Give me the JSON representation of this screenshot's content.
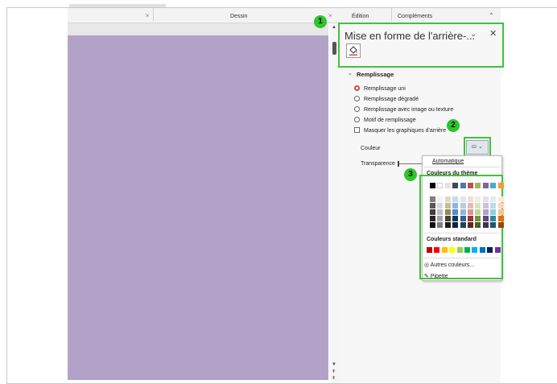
{
  "ribbon": {
    "groups": [
      {
        "label": "Dessin"
      },
      {
        "label": "Édition"
      },
      {
        "label": "Compléments"
      }
    ],
    "collapse_icon": "chevron-up-icon"
  },
  "pane": {
    "title": "Mise en forme de l'arrière-...",
    "fill_icon": "paint-bucket-icon",
    "section": "Remplissage",
    "options": [
      {
        "label": "Remplissage uni",
        "checked": true
      },
      {
        "label": "Remplissage dégradé",
        "checked": false
      },
      {
        "label": "Remplissage avec image ou texture",
        "checked": false
      },
      {
        "label": "Motif de remplissage",
        "checked": false
      }
    ],
    "hide_graphics": "Masquer les graphiques d'arrière",
    "color_label": "Couleur",
    "transparency_label": "Transparence"
  },
  "dropdown": {
    "automatic": "Automatique",
    "theme_heading": "Couleurs du thème",
    "standard_heading": "Couleurs standard",
    "more_colors": "Autres couleurs...",
    "eyedropper": "Pipette",
    "theme_top": [
      "#000000",
      "#ffffff",
      "#e8e2dc",
      "#3a4a5e",
      "#4a78b0",
      "#c0504d",
      "#9bbb59",
      "#8064a2",
      "#4bacc6",
      "#f79646"
    ],
    "theme_cols": [
      [
        "#7f7f7f",
        "#595959",
        "#404040",
        "#262626",
        "#0d0d0d"
      ],
      [
        "#f2f2f2",
        "#d9d9d9",
        "#bfbfbf",
        "#a6a6a6",
        "#7f7f7f"
      ],
      [
        "#ddd9c3",
        "#c4bd97",
        "#948a54",
        "#4a452a",
        "#1e1c11"
      ],
      [
        "#c6d9f0",
        "#8db3e2",
        "#548dd4",
        "#17365d",
        "#0f243e"
      ],
      [
        "#dbe5f1",
        "#b8cce4",
        "#95b3d7",
        "#366092",
        "#244061"
      ],
      [
        "#f2dcdb",
        "#e5b9b7",
        "#d99694",
        "#953734",
        "#632423"
      ],
      [
        "#ebf1dd",
        "#d7e3bc",
        "#c3d69b",
        "#76923c",
        "#4f6128"
      ],
      [
        "#e5e0ec",
        "#ccc1d9",
        "#b2a2c7",
        "#5f497a",
        "#3f3151"
      ],
      [
        "#dbeef3",
        "#b7dde8",
        "#92cddc",
        "#31859b",
        "#205867"
      ],
      [
        "#fdeada",
        "#fbd5b5",
        "#fac08f",
        "#e36c09",
        "#974806"
      ]
    ],
    "standard": [
      "#c00000",
      "#ff0000",
      "#ffc000",
      "#ffff00",
      "#92d050",
      "#00b050",
      "#00b0f0",
      "#0070c0",
      "#002060",
      "#7030a0"
    ]
  },
  "badges": [
    "1",
    "2",
    "3"
  ],
  "colors": {
    "slide": "#b3a2c8",
    "highlight": "#3fc33a",
    "badge": "#2ec52a",
    "selected_radio": "#d4493d"
  }
}
